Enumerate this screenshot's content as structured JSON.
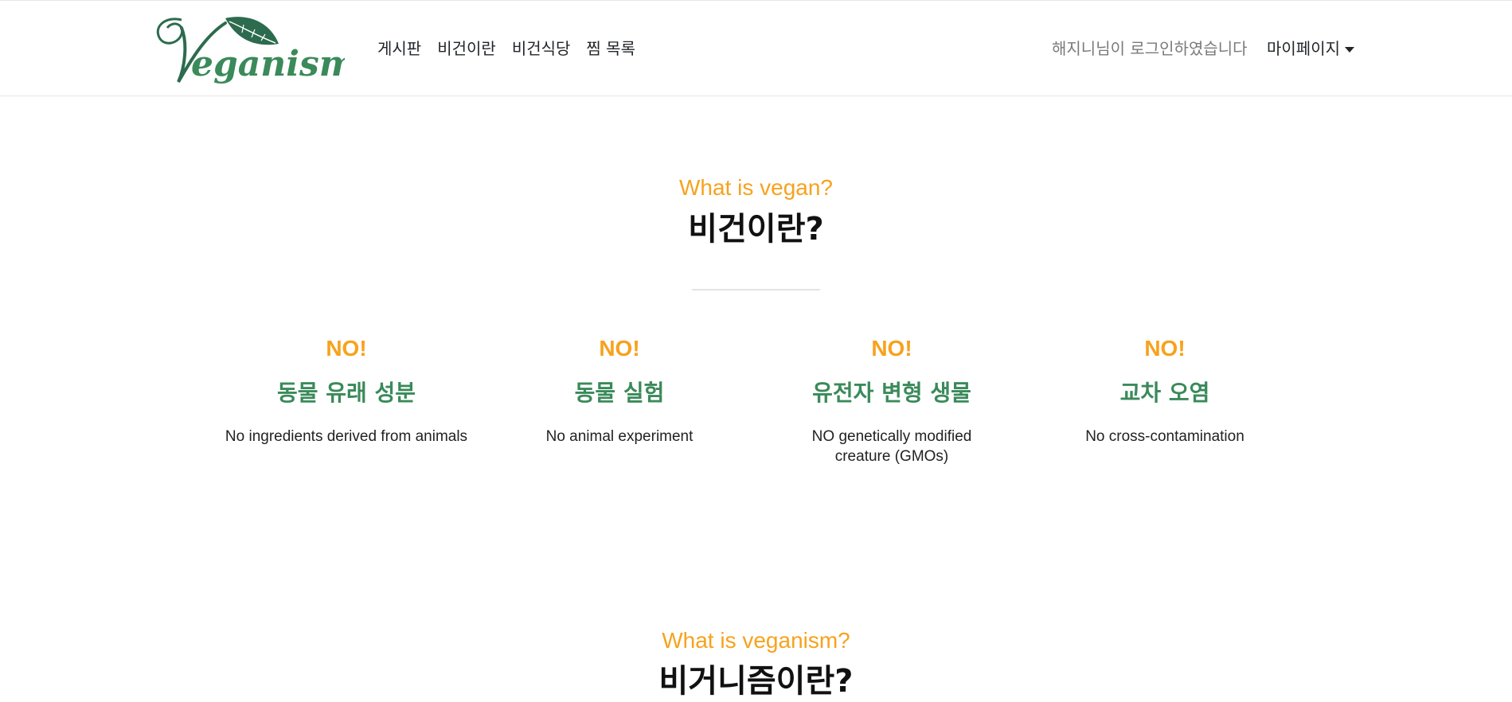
{
  "header": {
    "logo_text": "Veganism",
    "nav": [
      "게시판",
      "비건이란",
      "비건식당",
      "찜 목록"
    ],
    "login_message": "해지니님이 로그인하였습니다",
    "mypage_label": "마이페이지"
  },
  "colors": {
    "brand_green": "#2f7d4f",
    "dark_green": "#2d6b4e",
    "accent_orange": "#f7a21d",
    "feature_green": "#3a8a5a"
  },
  "vegan_section": {
    "subtitle": "What is vegan?",
    "title": "비건이란?",
    "features": [
      {
        "no": "NO!",
        "title": "동물 유래 성분",
        "desc": "No ingredients derived from animals"
      },
      {
        "no": "NO!",
        "title": "동물 실험",
        "desc": "No animal experiment"
      },
      {
        "no": "NO!",
        "title": "유전자 변형 생물",
        "desc": "NO genetically modified creature (GMOs)"
      },
      {
        "no": "NO!",
        "title": "교차 오염",
        "desc": "No cross-contamination"
      }
    ]
  },
  "veganism_section": {
    "subtitle": "What is veganism?",
    "title": "비거니즘이란?"
  }
}
